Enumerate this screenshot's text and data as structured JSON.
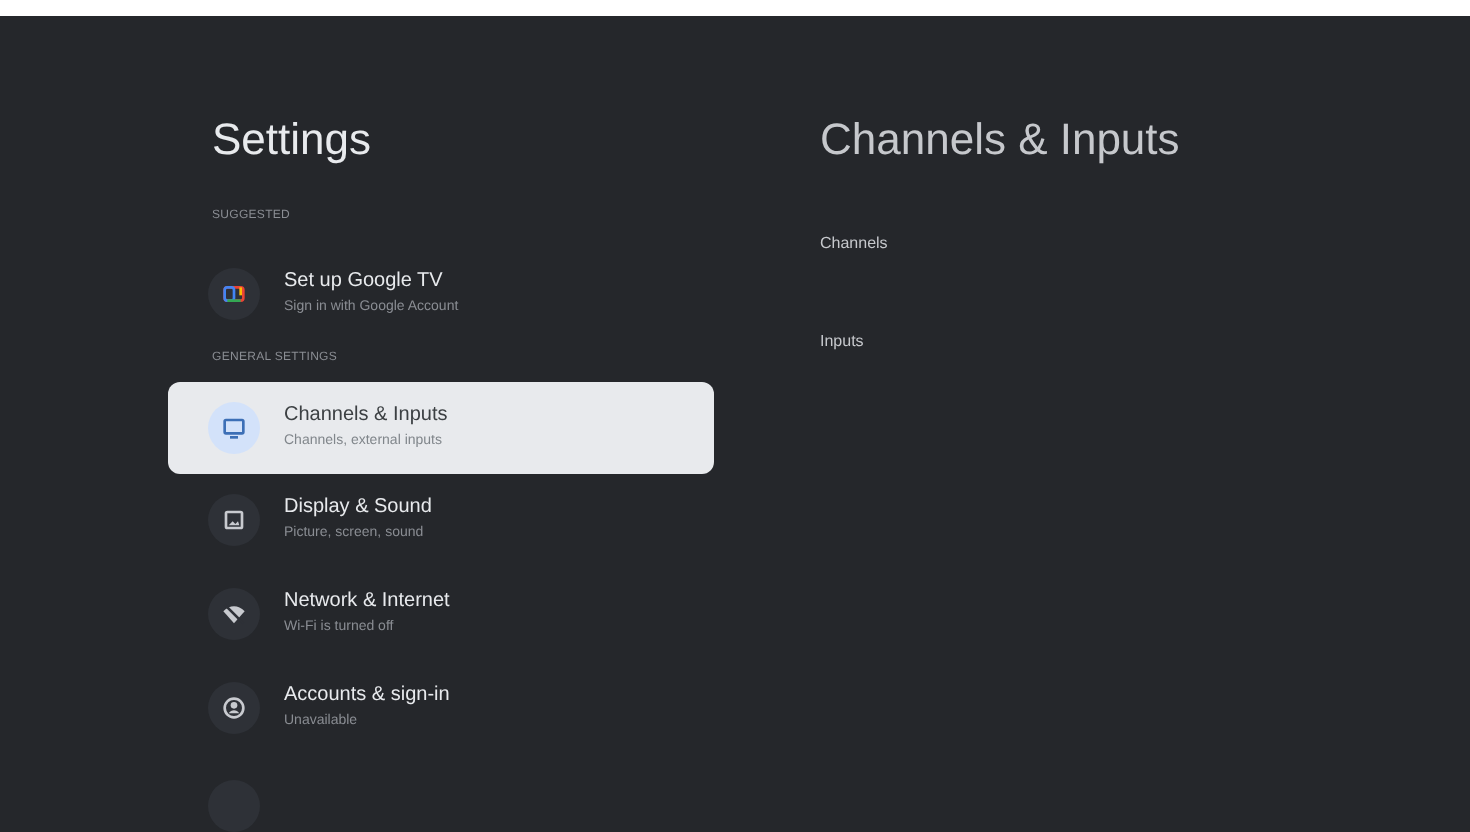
{
  "left_panel": {
    "title": "Settings",
    "sections": [
      {
        "heading": "SUGGESTED",
        "items": [
          {
            "kind": "google-tv",
            "title": "Set up Google TV",
            "subtitle": "Sign in with Google Account",
            "selected": false
          }
        ]
      },
      {
        "heading": "GENERAL SETTINGS",
        "items": [
          {
            "kind": "tv",
            "title": "Channels & Inputs",
            "subtitle": "Channels, external inputs",
            "selected": true
          },
          {
            "kind": "picture",
            "title": "Display & Sound",
            "subtitle": "Picture, screen, sound",
            "selected": false
          },
          {
            "kind": "wifi-off",
            "title": "Network & Internet",
            "subtitle": "Wi-Fi is turned off",
            "selected": false
          },
          {
            "kind": "account",
            "title": "Accounts & sign-in",
            "subtitle": "Unavailable",
            "selected": false
          }
        ]
      }
    ]
  },
  "right_panel": {
    "title": "Channels & Inputs",
    "items": [
      "Channels",
      "Inputs"
    ]
  }
}
